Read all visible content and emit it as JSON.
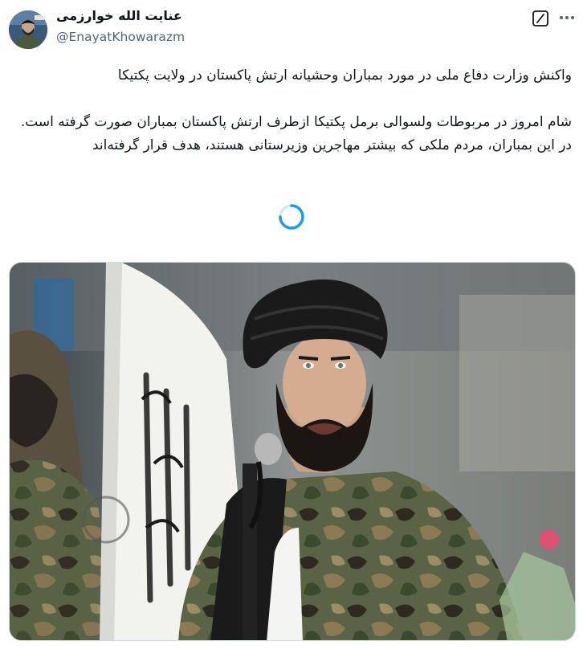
{
  "author": {
    "display_name": "عنایت الله خوارزمی",
    "handle": "@EnayatKhowarazm",
    "avatar_icon": "profile-avatar"
  },
  "header_icons": [
    "grok-icon",
    "more-options-icon"
  ],
  "tweet": {
    "headline": "واکنش وزارت دفاع ملی در مورد بمباران وحشیانه ارتش پاکستان در ولایت پکتیکا",
    "paragraph_1": "شام امروز در مربوطات ولسوالی برمل پکتیکا ازطرف ارتش پاکستان بمباران صورت گرفته است.",
    "paragraph_2": "در این بمباران، مردم ملکی که بیشتر مهاجرین وزیرستانی هستند، هدف قرار گرفته‌اند"
  },
  "loading_indicator": "spinner-icon",
  "media": {
    "description_icon": "speaker-photo",
    "accent_colors": {
      "turban": "#1a1a1a",
      "camouflage": "#4f5a3a",
      "flag": "#f4f4f2"
    }
  }
}
